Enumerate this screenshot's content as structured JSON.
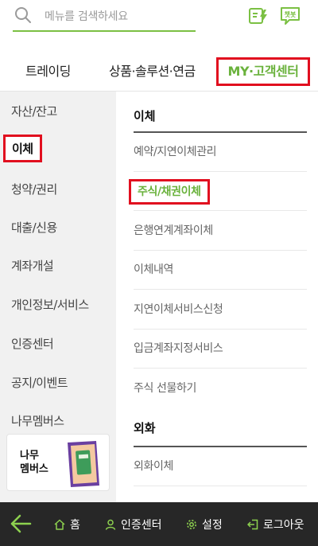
{
  "search": {
    "placeholder": "메뉴를 검색하세요",
    "icon": "search-icon"
  },
  "header_icons": [
    {
      "name": "quick-transfer-icon",
      "color": "#7bc043"
    },
    {
      "name": "chatbot-icon",
      "label": "챗봇",
      "color": "#7bc043"
    }
  ],
  "tabs": [
    {
      "label": "트레이딩"
    },
    {
      "label": "상품·솔루션·연금"
    },
    {
      "label": "MY·고객센터",
      "active": true
    }
  ],
  "left_menu": [
    {
      "label": "자산/잔고"
    },
    {
      "label": "이체",
      "active": true
    },
    {
      "label": "청약/권리"
    },
    {
      "label": "대출/신용"
    },
    {
      "label": "계좌개설"
    },
    {
      "label": "개인정보/서비스"
    },
    {
      "label": "인증센터"
    },
    {
      "label": "공지/이벤트"
    },
    {
      "label": "나무멤버스"
    }
  ],
  "banner": {
    "line1": "나무",
    "line2": "멤버스"
  },
  "right_menu": {
    "section1": {
      "title": "이체",
      "items": [
        "예약/지연이체관리",
        "주식/채권이체",
        "은행연계계좌이체",
        "이체내역",
        "지연이체서비스신청",
        "입금계좌지정서비스",
        "주식 선물하기"
      ],
      "highlighted_index": 1
    },
    "section2": {
      "title": "외화",
      "items": [
        "외화이체"
      ]
    }
  },
  "bottom_bar": {
    "home": "홈",
    "auth": "인증센터",
    "settings": "설정",
    "logout": "로그아웃"
  },
  "colors": {
    "accent": "#6ab23c",
    "highlight_border": "#e10f1f",
    "bottom_bg": "#272727"
  }
}
